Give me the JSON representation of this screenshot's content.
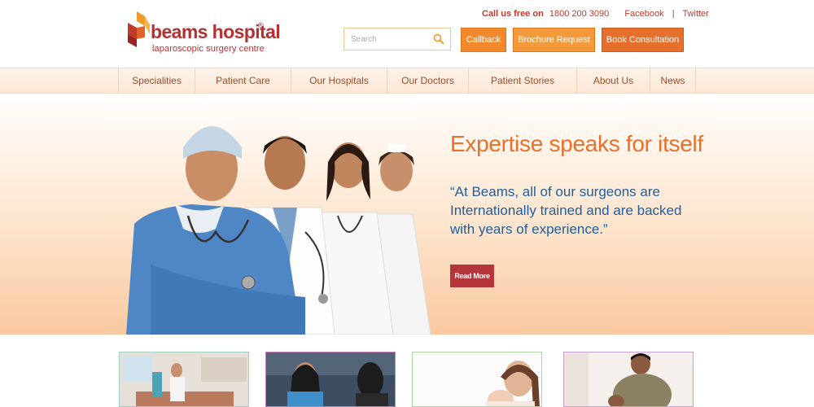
{
  "brand": {
    "name": "beams hospital",
    "registered": "®",
    "tagline": "laparoscopic surgery centre",
    "colors": {
      "primary": "#b53131",
      "orange": "#f28a2b",
      "blue": "#1f5f9e"
    }
  },
  "contact": {
    "call_label": "Call us free on",
    "phone": "1800 200 3090",
    "facebook": "Facebook",
    "separator": "|",
    "twitter": "Twitter"
  },
  "search": {
    "placeholder": "Search",
    "icon": "search-icon"
  },
  "header_buttons": {
    "callback": "Callback",
    "brochure": "Brochure Request",
    "book": "Book Consultation"
  },
  "nav": {
    "items": [
      {
        "label": "Specialities"
      },
      {
        "label": "Patient Care"
      },
      {
        "label": "Our Hospitals"
      },
      {
        "label": "Our Doctors"
      },
      {
        "label": "Patient Stories"
      },
      {
        "label": "About Us"
      },
      {
        "label": "News"
      }
    ]
  },
  "hero": {
    "title": "Expertise speaks for itself",
    "quote": "“At Beams, all of our surgeons are Internationally trained and are backed with years of experience.”",
    "button": "Read More",
    "image": "medical-team-photo"
  },
  "tiles": [
    {
      "image": "hospital-room-photo"
    },
    {
      "image": "front-desk-photo"
    },
    {
      "image": "mother-baby-photo"
    },
    {
      "image": "patient-consultation-photo"
    }
  ]
}
